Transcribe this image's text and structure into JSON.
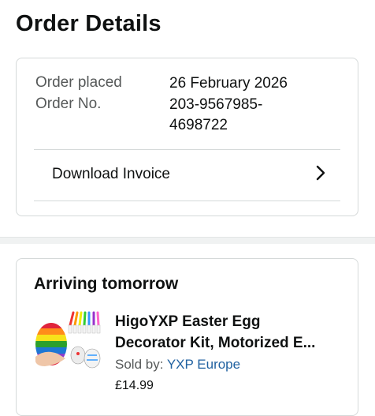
{
  "header": {
    "title": "Order Details"
  },
  "order": {
    "placed_label": "Order placed",
    "placed_value": "26 February 2026",
    "number_label": "Order No.",
    "number_value_line1": "203-9567985-",
    "number_value_line2": "4698722"
  },
  "invoice": {
    "label": "Download Invoice",
    "icon": "chevron-right-icon"
  },
  "shipment": {
    "status": "Arriving tomorrow",
    "product": {
      "title_line1": "HigoYXP Easter Egg",
      "title_line2": "Decorator Kit, Motorized E...",
      "sold_by_label": "Sold by: ",
      "seller": "YXP Europe",
      "price": "£14.99"
    }
  },
  "colors": {
    "link": "#2162a1",
    "border": "#d5d9d9",
    "muted": "#565959"
  }
}
